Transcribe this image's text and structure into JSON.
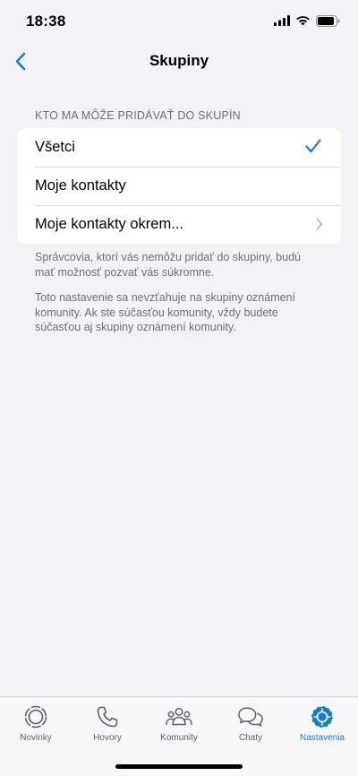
{
  "status_bar": {
    "time": "18:38"
  },
  "nav": {
    "title": "Skupiny",
    "back_icon": "chevron-left-icon"
  },
  "section": {
    "header": "KTO MA MÔŽE PRIDÁVAŤ DO SKUPÍN",
    "options": [
      {
        "label": "Všetci",
        "selected": true
      },
      {
        "label": "Moje kontakty",
        "selected": false
      },
      {
        "label": "Moje kontakty okrem...",
        "selected": false,
        "has_chevron": true
      }
    ]
  },
  "notes": {
    "note1": "Správcovia, ktorí vás nemôžu pridať do skupiny, budú mať možnosť pozvať vás súkromne.",
    "note2": "Toto nastavenie sa nevzťahuje na skupiny oznámení komunity. Ak ste súčasťou komunity, vždy budete súčasťou aj skupiny oznámení komunity."
  },
  "tabs": [
    {
      "label": "Novinky",
      "icon": "updates-icon",
      "active": false
    },
    {
      "label": "Hovory",
      "icon": "phone-icon",
      "active": false
    },
    {
      "label": "Komunity",
      "icon": "communities-icon",
      "active": false
    },
    {
      "label": "Chaty",
      "icon": "chats-icon",
      "active": false
    },
    {
      "label": "Nastavenia",
      "icon": "settings-icon",
      "active": true
    }
  ],
  "colors": {
    "accent": "#1a7fc2",
    "background": "#f2f2f7",
    "secondary_text": "#6d6d72"
  }
}
